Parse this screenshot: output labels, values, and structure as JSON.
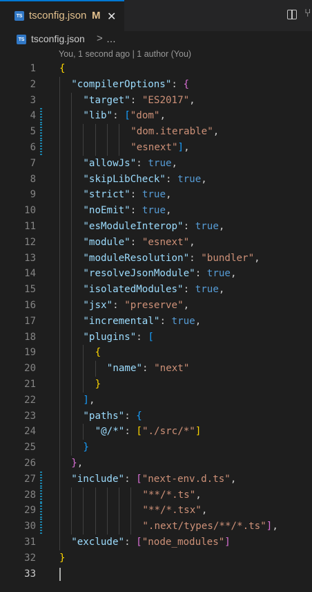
{
  "tab": {
    "title": "tsconfig.json",
    "status": "M",
    "file_icon": "TS",
    "close_icon": "close-icon"
  },
  "toolbar": {
    "icons": [
      "split-editor-icon",
      "git-compare-icon"
    ]
  },
  "breadcrumb": {
    "file": "tsconfig.json",
    "separator": ">",
    "more": "…"
  },
  "blame": "You, 1 second ago | 1 author (You)",
  "colors": {
    "bracket_level_1": "#ffd700",
    "bracket_level_2": "#da70d6",
    "bracket_level_3": "#179fff",
    "json_key": "#9cdcfe",
    "json_string": "#ce9178",
    "json_boolean": "#569cd6",
    "modified_gutter": "#1b81a8",
    "active_tab_border": "#0078d4",
    "tab_modified_text": "#e2c08d"
  },
  "editor": {
    "current_line": 33,
    "modified_lines": [
      4,
      5,
      6,
      27,
      28,
      29,
      30
    ],
    "lines": [
      {
        "n": "1",
        "indent": 0,
        "tokens": [
          {
            "t": "{",
            "c": "b1"
          }
        ]
      },
      {
        "n": "2",
        "indent": 2,
        "tokens": [
          {
            "t": "\"compilerOptions\"",
            "c": "key"
          },
          {
            "t": ": ",
            "c": "p"
          },
          {
            "t": "{",
            "c": "b2"
          }
        ]
      },
      {
        "n": "3",
        "indent": 4,
        "tokens": [
          {
            "t": "\"target\"",
            "c": "key"
          },
          {
            "t": ": ",
            "c": "p"
          },
          {
            "t": "\"ES2017\"",
            "c": "str"
          },
          {
            "t": ",",
            "c": "p"
          }
        ]
      },
      {
        "n": "4",
        "indent": 4,
        "tokens": [
          {
            "t": "\"lib\"",
            "c": "key"
          },
          {
            "t": ": ",
            "c": "p"
          },
          {
            "t": "[",
            "c": "b3"
          },
          {
            "t": "\"dom\"",
            "c": "str"
          },
          {
            "t": ",",
            "c": "p"
          }
        ]
      },
      {
        "n": "5",
        "indent": 12,
        "tokens": [
          {
            "t": "\"dom.iterable\"",
            "c": "str"
          },
          {
            "t": ",",
            "c": "p"
          }
        ]
      },
      {
        "n": "6",
        "indent": 12,
        "tokens": [
          {
            "t": "\"esnext\"",
            "c": "str"
          },
          {
            "t": "]",
            "c": "b3"
          },
          {
            "t": ",",
            "c": "p"
          }
        ]
      },
      {
        "n": "7",
        "indent": 4,
        "tokens": [
          {
            "t": "\"allowJs\"",
            "c": "key"
          },
          {
            "t": ": ",
            "c": "p"
          },
          {
            "t": "true",
            "c": "bool"
          },
          {
            "t": ",",
            "c": "p"
          }
        ]
      },
      {
        "n": "8",
        "indent": 4,
        "tokens": [
          {
            "t": "\"skipLibCheck\"",
            "c": "key"
          },
          {
            "t": ": ",
            "c": "p"
          },
          {
            "t": "true",
            "c": "bool"
          },
          {
            "t": ",",
            "c": "p"
          }
        ]
      },
      {
        "n": "9",
        "indent": 4,
        "tokens": [
          {
            "t": "\"strict\"",
            "c": "key"
          },
          {
            "t": ": ",
            "c": "p"
          },
          {
            "t": "true",
            "c": "bool"
          },
          {
            "t": ",",
            "c": "p"
          }
        ]
      },
      {
        "n": "10",
        "indent": 4,
        "tokens": [
          {
            "t": "\"noEmit\"",
            "c": "key"
          },
          {
            "t": ": ",
            "c": "p"
          },
          {
            "t": "true",
            "c": "bool"
          },
          {
            "t": ",",
            "c": "p"
          }
        ]
      },
      {
        "n": "11",
        "indent": 4,
        "tokens": [
          {
            "t": "\"esModuleInterop\"",
            "c": "key"
          },
          {
            "t": ": ",
            "c": "p"
          },
          {
            "t": "true",
            "c": "bool"
          },
          {
            "t": ",",
            "c": "p"
          }
        ]
      },
      {
        "n": "12",
        "indent": 4,
        "tokens": [
          {
            "t": "\"module\"",
            "c": "key"
          },
          {
            "t": ": ",
            "c": "p"
          },
          {
            "t": "\"esnext\"",
            "c": "str"
          },
          {
            "t": ",",
            "c": "p"
          }
        ]
      },
      {
        "n": "13",
        "indent": 4,
        "tokens": [
          {
            "t": "\"moduleResolution\"",
            "c": "key"
          },
          {
            "t": ": ",
            "c": "p"
          },
          {
            "t": "\"bundler\"",
            "c": "str"
          },
          {
            "t": ",",
            "c": "p"
          }
        ]
      },
      {
        "n": "14",
        "indent": 4,
        "tokens": [
          {
            "t": "\"resolveJsonModule\"",
            "c": "key"
          },
          {
            "t": ": ",
            "c": "p"
          },
          {
            "t": "true",
            "c": "bool"
          },
          {
            "t": ",",
            "c": "p"
          }
        ]
      },
      {
        "n": "15",
        "indent": 4,
        "tokens": [
          {
            "t": "\"isolatedModules\"",
            "c": "key"
          },
          {
            "t": ": ",
            "c": "p"
          },
          {
            "t": "true",
            "c": "bool"
          },
          {
            "t": ",",
            "c": "p"
          }
        ]
      },
      {
        "n": "16",
        "indent": 4,
        "tokens": [
          {
            "t": "\"jsx\"",
            "c": "key"
          },
          {
            "t": ": ",
            "c": "p"
          },
          {
            "t": "\"preserve\"",
            "c": "str"
          },
          {
            "t": ",",
            "c": "p"
          }
        ]
      },
      {
        "n": "17",
        "indent": 4,
        "tokens": [
          {
            "t": "\"incremental\"",
            "c": "key"
          },
          {
            "t": ": ",
            "c": "p"
          },
          {
            "t": "true",
            "c": "bool"
          },
          {
            "t": ",",
            "c": "p"
          }
        ]
      },
      {
        "n": "18",
        "indent": 4,
        "tokens": [
          {
            "t": "\"plugins\"",
            "c": "key"
          },
          {
            "t": ": ",
            "c": "p"
          },
          {
            "t": "[",
            "c": "b3"
          }
        ]
      },
      {
        "n": "19",
        "indent": 6,
        "tokens": [
          {
            "t": "{",
            "c": "b1"
          }
        ]
      },
      {
        "n": "20",
        "indent": 8,
        "tokens": [
          {
            "t": "\"name\"",
            "c": "key"
          },
          {
            "t": ": ",
            "c": "p"
          },
          {
            "t": "\"next\"",
            "c": "str"
          }
        ]
      },
      {
        "n": "21",
        "indent": 6,
        "tokens": [
          {
            "t": "}",
            "c": "b1"
          }
        ]
      },
      {
        "n": "22",
        "indent": 4,
        "tokens": [
          {
            "t": "]",
            "c": "b3"
          },
          {
            "t": ",",
            "c": "p"
          }
        ]
      },
      {
        "n": "23",
        "indent": 4,
        "tokens": [
          {
            "t": "\"paths\"",
            "c": "key"
          },
          {
            "t": ": ",
            "c": "p"
          },
          {
            "t": "{",
            "c": "b3"
          }
        ]
      },
      {
        "n": "24",
        "indent": 6,
        "tokens": [
          {
            "t": "\"@/*\"",
            "c": "key"
          },
          {
            "t": ": ",
            "c": "p"
          },
          {
            "t": "[",
            "c": "b1"
          },
          {
            "t": "\"./src/*\"",
            "c": "str"
          },
          {
            "t": "]",
            "c": "b1"
          }
        ]
      },
      {
        "n": "25",
        "indent": 4,
        "tokens": [
          {
            "t": "}",
            "c": "b3"
          }
        ]
      },
      {
        "n": "26",
        "indent": 2,
        "tokens": [
          {
            "t": "}",
            "c": "b2"
          },
          {
            "t": ",",
            "c": "p"
          }
        ]
      },
      {
        "n": "27",
        "indent": 2,
        "tokens": [
          {
            "t": "\"include\"",
            "c": "key"
          },
          {
            "t": ": ",
            "c": "p"
          },
          {
            "t": "[",
            "c": "b2"
          },
          {
            "t": "\"next-env.d.ts\"",
            "c": "str"
          },
          {
            "t": ",",
            "c": "p"
          }
        ]
      },
      {
        "n": "28",
        "indent": 14,
        "tokens": [
          {
            "t": "\"**/*.ts\"",
            "c": "str"
          },
          {
            "t": ",",
            "c": "p"
          }
        ]
      },
      {
        "n": "29",
        "indent": 14,
        "tokens": [
          {
            "t": "\"**/*.tsx\"",
            "c": "str"
          },
          {
            "t": ",",
            "c": "p"
          }
        ]
      },
      {
        "n": "30",
        "indent": 14,
        "tokens": [
          {
            "t": "\".next/types/**/*.ts\"",
            "c": "str"
          },
          {
            "t": "]",
            "c": "b2"
          },
          {
            "t": ",",
            "c": "p"
          }
        ]
      },
      {
        "n": "31",
        "indent": 2,
        "tokens": [
          {
            "t": "\"exclude\"",
            "c": "key"
          },
          {
            "t": ": ",
            "c": "p"
          },
          {
            "t": "[",
            "c": "b2"
          },
          {
            "t": "\"node_modules\"",
            "c": "str"
          },
          {
            "t": "]",
            "c": "b2"
          }
        ]
      },
      {
        "n": "32",
        "indent": 0,
        "tokens": [
          {
            "t": "}",
            "c": "b1"
          }
        ]
      },
      {
        "n": "33",
        "indent": 0,
        "tokens": []
      }
    ]
  }
}
